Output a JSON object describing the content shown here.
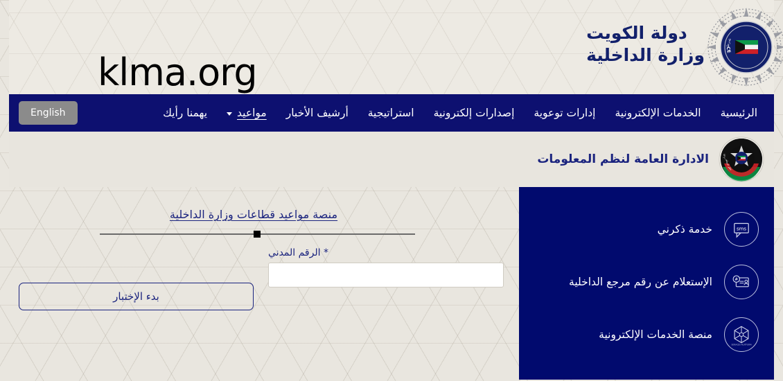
{
  "watermark": {
    "text": "klma.org"
  },
  "header": {
    "brand_line1": "دولة الكويت",
    "brand_line2": "وزارة الداخلية",
    "emblem_name": "kuwait-police-emblem",
    "emblem_text": "KUWAIT POLICE"
  },
  "nav": {
    "language_button": "English",
    "items": [
      {
        "label": "الرئيسية",
        "active": false,
        "has_caret": false
      },
      {
        "label": "الخدمات الإلكترونية",
        "active": false,
        "has_caret": false
      },
      {
        "label": "إدارات توعوية",
        "active": false,
        "has_caret": false
      },
      {
        "label": "إصدارات إلكترونية",
        "active": false,
        "has_caret": false
      },
      {
        "label": "استراتيجية",
        "active": false,
        "has_caret": false
      },
      {
        "label": "أرشيف الأخبار",
        "active": false,
        "has_caret": false
      },
      {
        "label": "مواعيد",
        "active": true,
        "has_caret": true
      },
      {
        "label": "يهمنا رأيك",
        "active": false,
        "has_caret": false
      }
    ]
  },
  "sub_header": {
    "department_title": "الادارة العامة لنظم المعلومات",
    "logo_name": "information-systems-department-logo"
  },
  "main": {
    "section_title": "منصة مواعيد قطاعات وزارة الداخلية",
    "slider_position_percent": 50,
    "field_label": "الرقم المدني",
    "required_marker": "*",
    "field_value": "",
    "field_placeholder": "",
    "submit_label": "بدء الإختبار"
  },
  "quick_links": {
    "items": [
      {
        "label": "خدمة ذكرني",
        "icon": "sms-bubble-icon",
        "icon_text": "sms"
      },
      {
        "label": "الإستعلام عن رقم مرجع الداخلية",
        "icon": "reference-lookup-icon",
        "icon_text": "#"
      },
      {
        "label": "منصة الخدمات الإلكترونية",
        "icon": "e-services-platform-icon",
        "icon_text": ""
      }
    ]
  },
  "colors": {
    "navy": "#0d1070",
    "panel_navy": "#010a6e",
    "brand_blue": "#1a237e",
    "page_bg": "#e8e5de",
    "lang_button_gray": "#8b8b8b"
  }
}
